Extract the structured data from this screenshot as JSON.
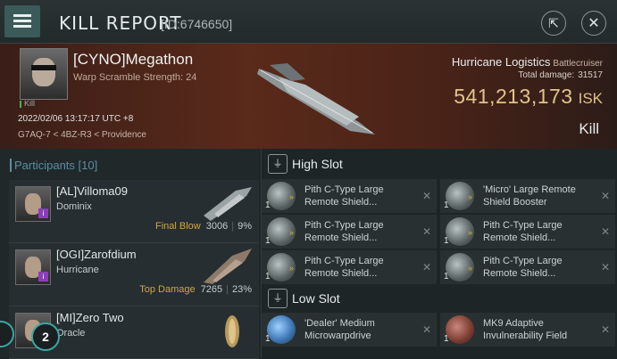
{
  "topbar": {
    "title": "KILL REPORT",
    "id_text": "[ID:6746650]",
    "menu_icon": "hamburger-icon",
    "share_icon": "share-icon",
    "close_icon": "close-icon"
  },
  "victim": {
    "name": "[CYNO]Megathon",
    "warp_scramble": "Warp Scramble Strength: 24",
    "tag": "Kill",
    "datetime": "2022/02/06 13:17:17 UTC +8",
    "location": "G7AQ-7 < 4BZ-R3 < Providence",
    "ship_name": "Hurricane Logistics",
    "ship_class": "Battlecruiser",
    "total_damage_label": "Total damage:",
    "total_damage": "31517",
    "isk_value": "541,213,173",
    "isk_unit": "ISK",
    "result": "Kill"
  },
  "participants": {
    "header": "Participants [10]",
    "list": [
      {
        "name": "[AL]Villoma09",
        "ship": "Dominix",
        "role": "Final Blow",
        "damage": "3006",
        "percent": "9%"
      },
      {
        "name": "[OGI]Zarofdium",
        "ship": "Hurricane",
        "role": "Top Damage",
        "damage": "7265",
        "percent": "23%"
      },
      {
        "name": "[MI]Zero Two",
        "ship": "Oracle"
      }
    ],
    "badge": "2"
  },
  "high_slot": {
    "title": "High Slot",
    "modules": [
      {
        "qty": "1",
        "name": "Pith C-Type Large Remote Shield..."
      },
      {
        "qty": "1",
        "name": "'Micro' Large Remote Shield Booster"
      },
      {
        "qty": "1",
        "name": "Pith C-Type Large Remote Shield..."
      },
      {
        "qty": "1",
        "name": "Pith C-Type Large Remote Shield..."
      },
      {
        "qty": "1",
        "name": "Pith C-Type Large Remote Shield..."
      },
      {
        "qty": "1",
        "name": "Pith C-Type Large Remote Shield..."
      }
    ]
  },
  "low_slot": {
    "title": "Low Slot",
    "modules": [
      {
        "qty": "1",
        "name": "'Dealer' Medium Microwarpdrive"
      },
      {
        "qty": "1",
        "name": "MK9 Adaptive Invulnerability Field"
      }
    ]
  },
  "colors": {
    "accent_teal": "#3aa7a0",
    "isk_gold": "#e0c48a",
    "final_blow": "#d4a544",
    "header_red": "#5a2a1a"
  }
}
